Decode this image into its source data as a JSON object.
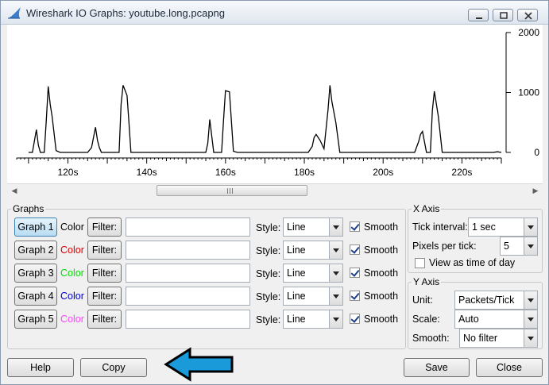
{
  "window": {
    "title": "Wireshark IO Graphs: youtube.long.pcapng"
  },
  "chart_data": {
    "type": "line",
    "title": "",
    "xlabel": "",
    "ylabel": "",
    "x_ticks": [
      "120s",
      "140s",
      "160s",
      "180s",
      "200s",
      "220s"
    ],
    "x_tick_values": [
      120,
      140,
      160,
      180,
      200,
      220
    ],
    "y_ticks": [
      "2000",
      "1000",
      "0"
    ],
    "y_tick_values": [
      2000,
      1000,
      0
    ],
    "xlim": [
      107,
      230
    ],
    "ylim": [
      0,
      2000
    ],
    "y_axis_side": "right",
    "grid": false,
    "series": [
      {
        "color": "#000000",
        "x": [
          110,
          111,
          112,
          112.5,
          113,
          114,
          114.5,
          115,
          115.5,
          116,
          117,
          118,
          122,
          124,
          125,
          126,
          126.5,
          127,
          127.5,
          128,
          128.5,
          129,
          132,
          133,
          133.5,
          134,
          135,
          135.5,
          136,
          137,
          140,
          154,
          155,
          155.5,
          156,
          157,
          158,
          159,
          159.5,
          160,
          161,
          162,
          163,
          164,
          180,
          181,
          182,
          182.5,
          183,
          184,
          185,
          186,
          186.5,
          187,
          188,
          189,
          190,
          207,
          208,
          209,
          209.5,
          210,
          211,
          212,
          212.5,
          213,
          214,
          215,
          216,
          228,
          229,
          230
        ],
        "y": [
          0,
          0,
          380,
          120,
          0,
          0,
          520,
          1100,
          800,
          600,
          30,
          0,
          0,
          0,
          0,
          80,
          250,
          420,
          200,
          80,
          0,
          0,
          0,
          0,
          800,
          1120,
          950,
          500,
          0,
          0,
          0,
          0,
          0,
          150,
          550,
          0,
          0,
          0,
          550,
          1030,
          1010,
          20,
          0,
          0,
          0,
          0,
          100,
          250,
          300,
          200,
          60,
          700,
          1120,
          850,
          500,
          0,
          0,
          0,
          0,
          180,
          300,
          350,
          0,
          0,
          700,
          1020,
          600,
          0,
          0,
          0,
          10,
          0
        ]
      }
    ]
  },
  "scrollbar": {
    "grip": "|||"
  },
  "graphs": {
    "legend": "Graphs",
    "color_label": "Color",
    "filter_label": "Filter:",
    "style_label": "Style:",
    "smooth_label": "Smooth",
    "rows": [
      {
        "button": "Graph 1",
        "color": "#000000",
        "filter": "",
        "style": "Line",
        "smooth": true,
        "active": true
      },
      {
        "button": "Graph 2",
        "color": "#dd0000",
        "filter": "",
        "style": "Line",
        "smooth": true,
        "active": false
      },
      {
        "button": "Graph 3",
        "color": "#00dd00",
        "filter": "",
        "style": "Line",
        "smooth": true,
        "active": false
      },
      {
        "button": "Graph 4",
        "color": "#0000cc",
        "filter": "",
        "style": "Line",
        "smooth": true,
        "active": false
      },
      {
        "button": "Graph 5",
        "color": "#ff44ff",
        "filter": "",
        "style": "Line",
        "smooth": true,
        "active": false
      }
    ]
  },
  "x_axis": {
    "legend": "X Axis",
    "tick_interval_label": "Tick interval:",
    "tick_interval_value": "1 sec",
    "pixels_per_tick_label": "Pixels per tick:",
    "pixels_per_tick_value": "5",
    "view_as_time_label": "View as time of day",
    "view_as_time_checked": false
  },
  "y_axis": {
    "legend": "Y Axis",
    "unit_label": "Unit:",
    "unit_value": "Packets/Tick",
    "scale_label": "Scale:",
    "scale_value": "Auto",
    "smooth_label": "Smooth:",
    "smooth_value": "No filter"
  },
  "footer": {
    "help": "Help",
    "copy": "Copy",
    "save": "Save",
    "close": "Close"
  },
  "annotation": {
    "arrow_color": "#1a9ad9"
  }
}
